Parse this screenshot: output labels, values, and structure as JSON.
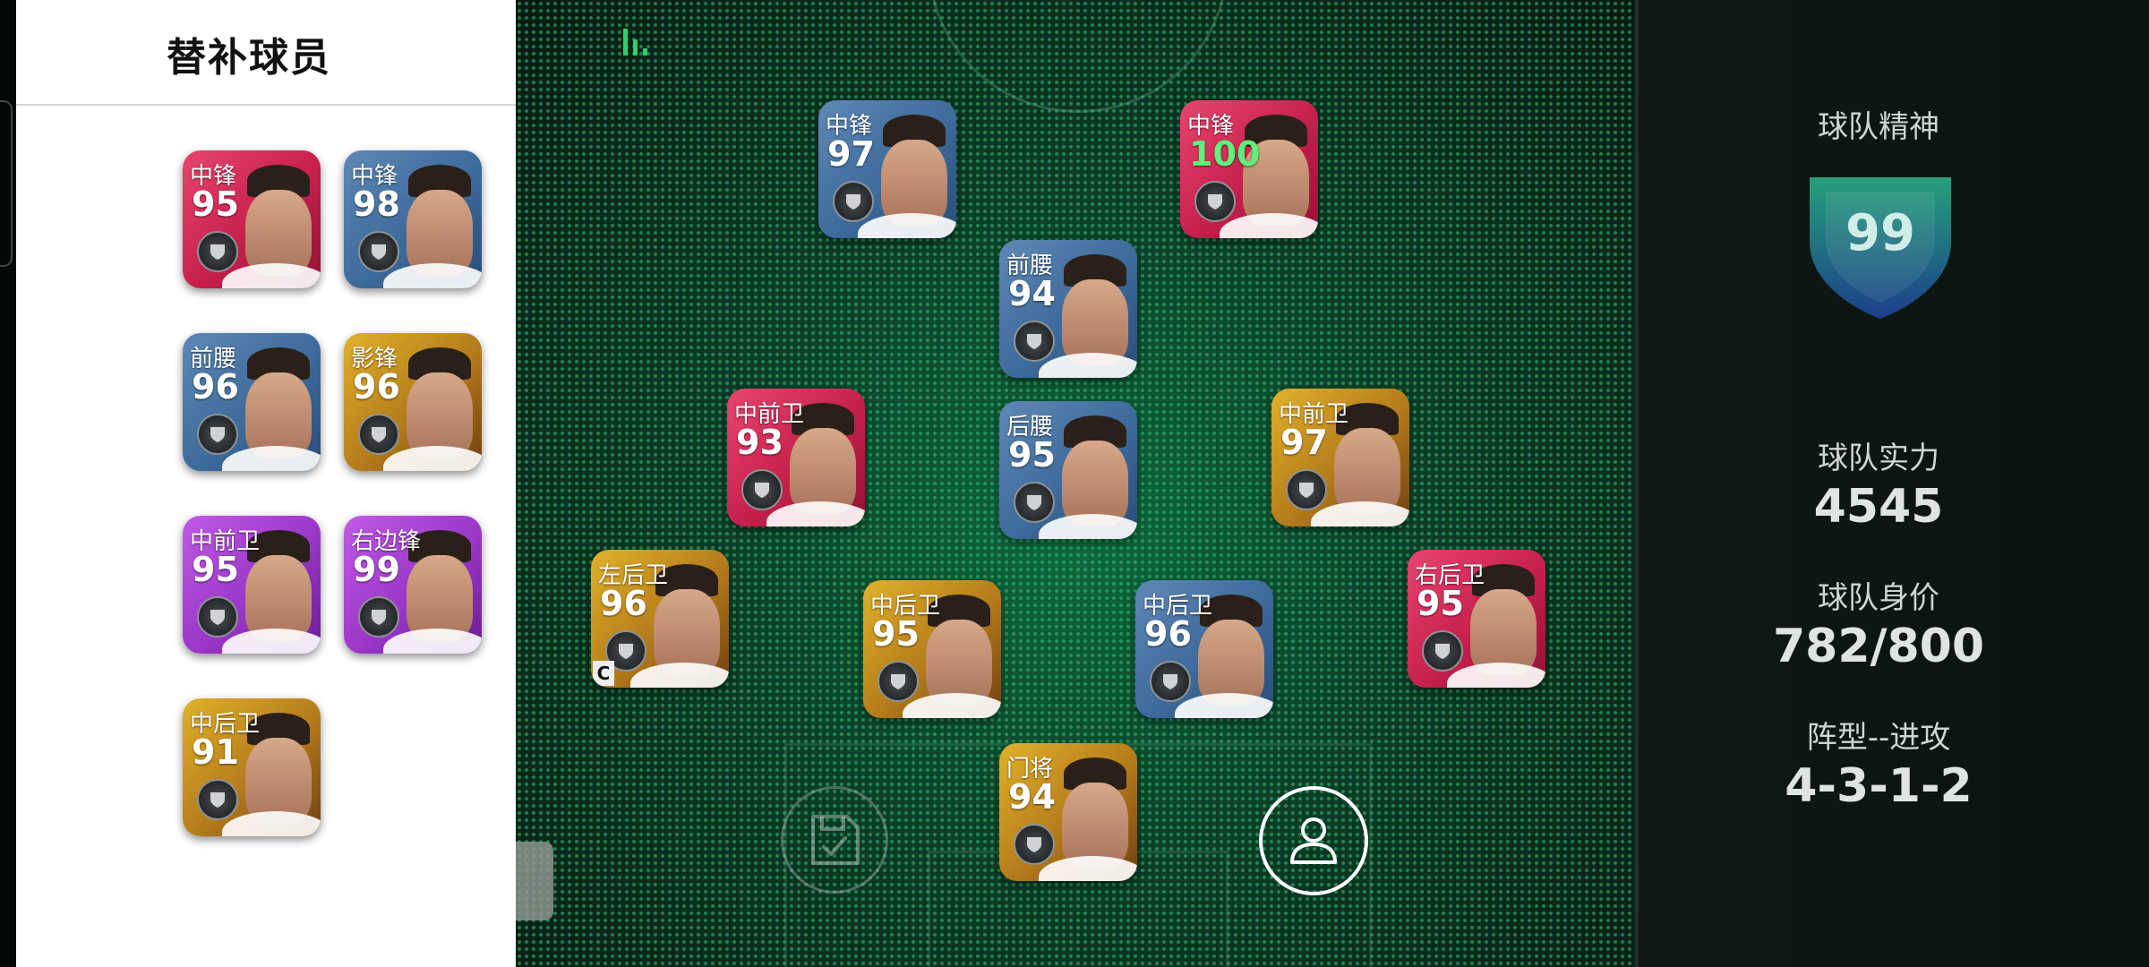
{
  "subs": {
    "title": "替补球员",
    "players": [
      {
        "position": "中锋",
        "rating": "95",
        "color": "red"
      },
      {
        "position": "中锋",
        "rating": "98",
        "color": "blue"
      },
      {
        "position": "前腰",
        "rating": "96",
        "color": "blue"
      },
      {
        "position": "影锋",
        "rating": "96",
        "color": "gold"
      },
      {
        "position": "中前卫",
        "rating": "95",
        "color": "purple"
      },
      {
        "position": "右边锋",
        "rating": "99",
        "color": "purple"
      },
      {
        "position": "中后卫",
        "rating": "91",
        "color": "gold"
      }
    ]
  },
  "lineup": {
    "players": [
      {
        "position": "中锋",
        "rating": "97",
        "color": "blue"
      },
      {
        "position": "中锋",
        "rating": "100",
        "color": "red"
      },
      {
        "position": "前腰",
        "rating": "94",
        "color": "blue"
      },
      {
        "position": "中前卫",
        "rating": "93",
        "color": "red"
      },
      {
        "position": "后腰",
        "rating": "95",
        "color": "blue"
      },
      {
        "position": "中前卫",
        "rating": "97",
        "color": "gold"
      },
      {
        "position": "左后卫",
        "rating": "96",
        "color": "gold",
        "captain": "C"
      },
      {
        "position": "中后卫",
        "rating": "95",
        "color": "gold"
      },
      {
        "position": "中后卫",
        "rating": "96",
        "color": "blue"
      },
      {
        "position": "右后卫",
        "rating": "95",
        "color": "red"
      },
      {
        "position": "门将",
        "rating": "94",
        "color": "gold"
      }
    ]
  },
  "stats": {
    "team_spirit_label": "球队精神",
    "team_spirit_value": "99",
    "team_strength_label": "球队实力",
    "team_strength_value": "4545",
    "team_value_label": "球队身价",
    "team_value_value": "782/800",
    "formation_label": "阵型--进攻",
    "formation_value": "4-3-1-2"
  },
  "icons": {
    "signal": "signal-strength-icon",
    "save": "save-lineup-icon",
    "person": "player-profile-icon",
    "team_badge": "team-badge-icon"
  },
  "colors": {
    "accent_green": "#2ed06b",
    "rating_highlight": "#5ef07a",
    "shield_top": "#1f8a63",
    "shield_bottom": "#1b3f8a"
  }
}
